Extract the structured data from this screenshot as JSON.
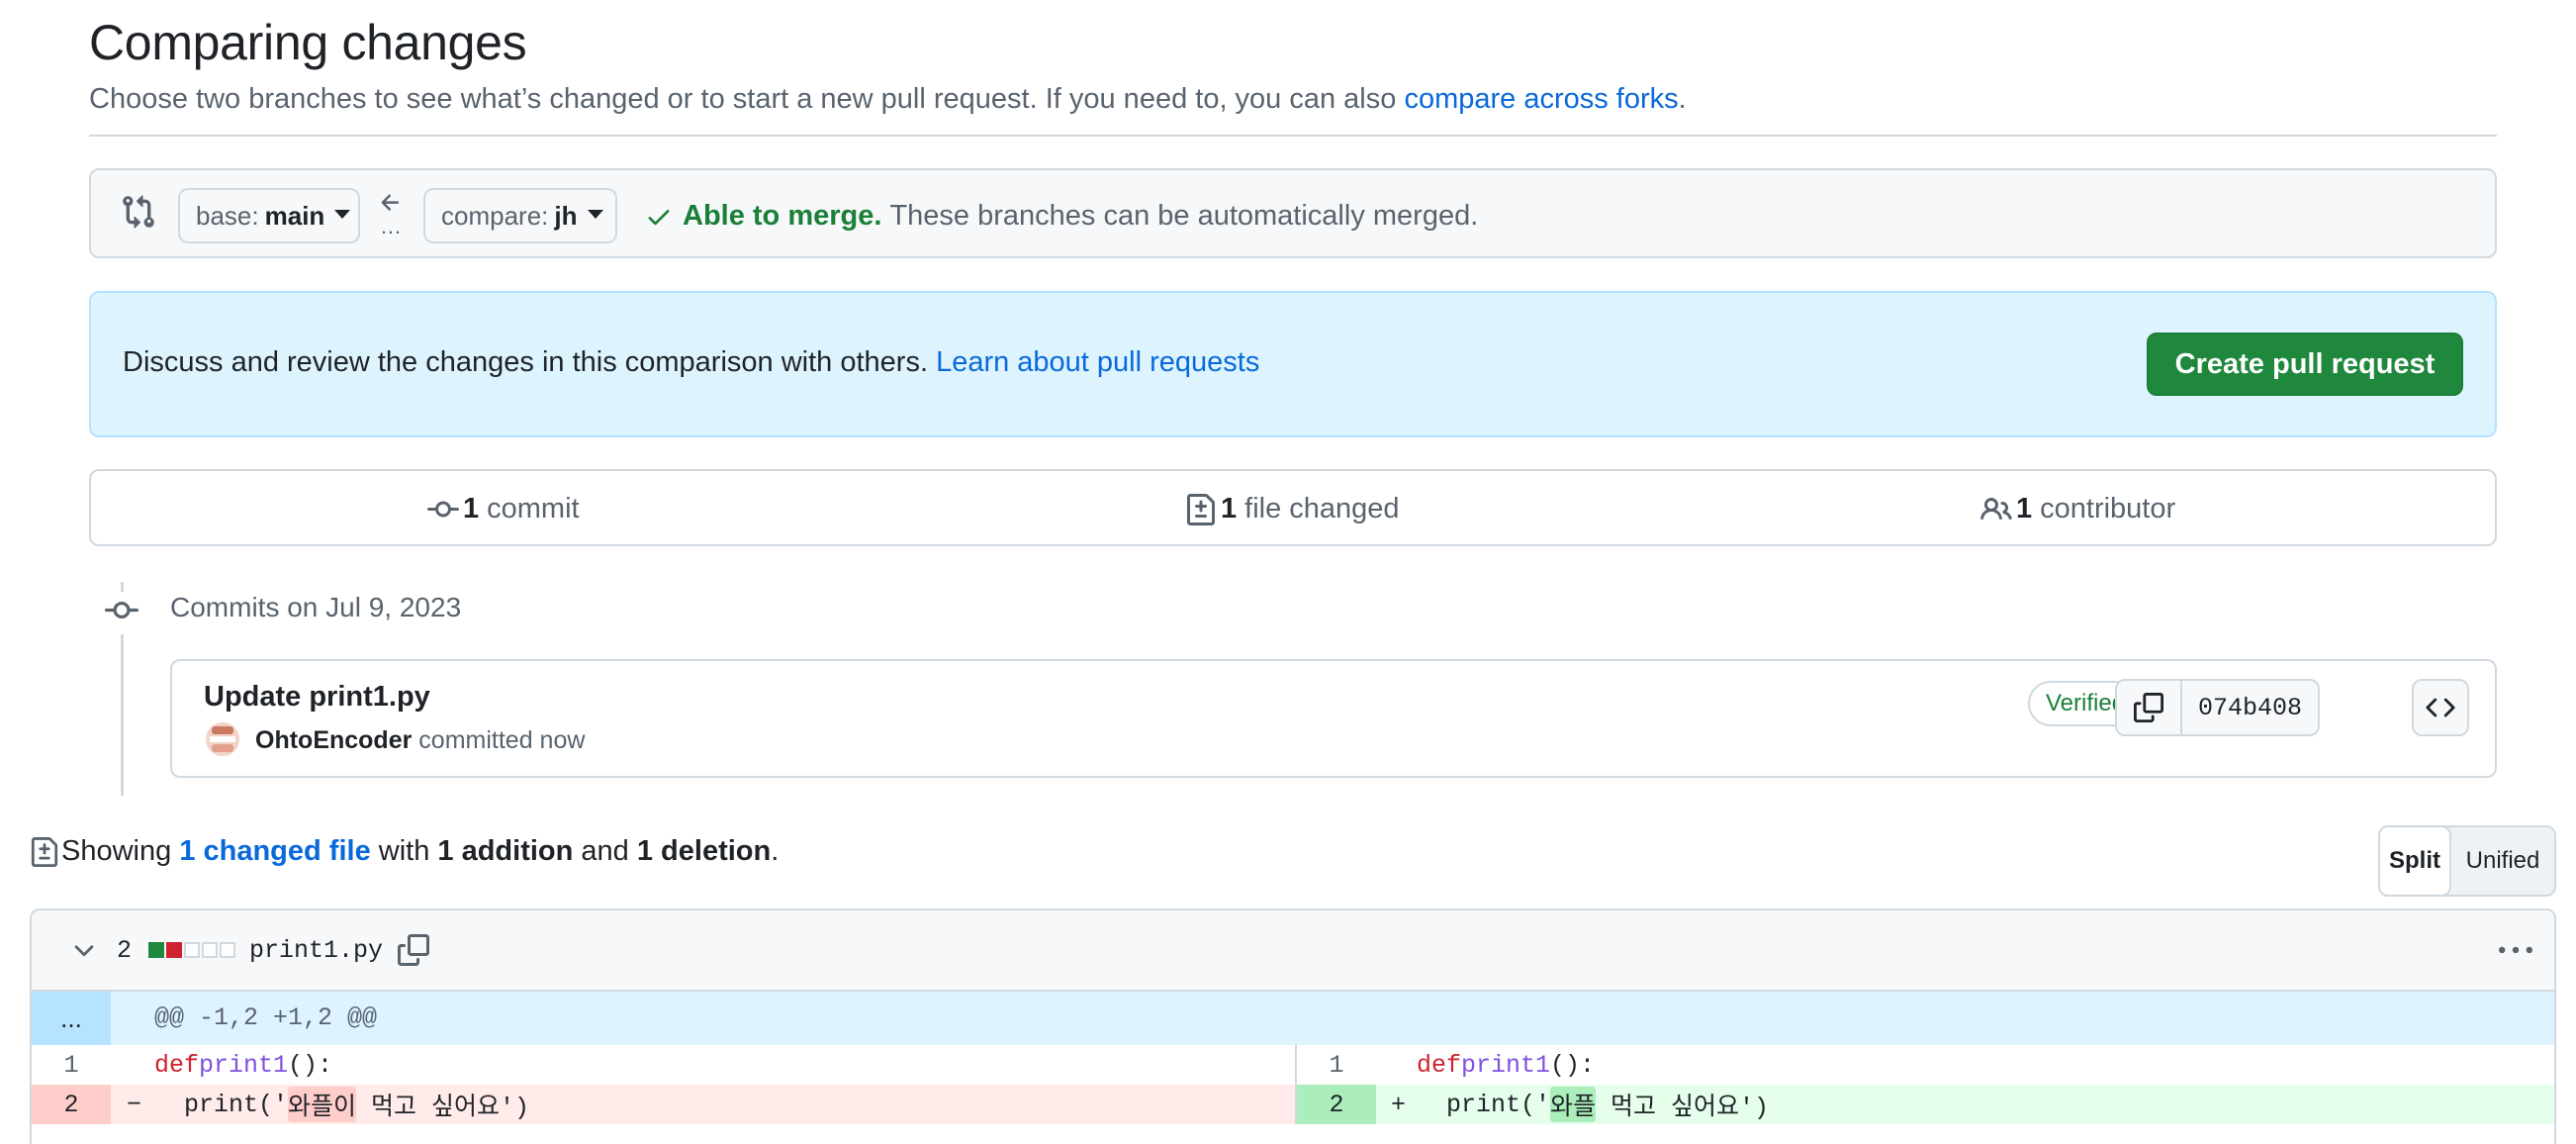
{
  "header": {
    "title": "Comparing changes",
    "subtitle": "Choose two branches to see what’s changed or to start a new pull request. If you need to, you can also ",
    "subtitle_link": "compare across forks",
    "subtitle_end": "."
  },
  "compare": {
    "base_label": "base:",
    "base_value": "main",
    "compare_label": "compare:",
    "compare_value": "jh",
    "merge_ok": "Able to merge.",
    "merge_text": "These branches can be automatically merged."
  },
  "flash": {
    "text": "Discuss and review the changes in this comparison with others. ",
    "link": "Learn about pull requests",
    "button": "Create pull request"
  },
  "summary": {
    "commits_count": "1",
    "commits_label": "commit",
    "files_count": "1",
    "files_label": "file changed",
    "contributors_count": "1",
    "contributors_label": "contributor"
  },
  "timeline": {
    "date_heading": "Commits on Jul 9, 2023",
    "commit": {
      "title": "Update print1.py",
      "author": "OhtoEncoder",
      "time": "committed now",
      "verified": "Verified",
      "sha": "074b408"
    }
  },
  "showing": {
    "prefix": "Showing",
    "files_link": "1 changed file",
    "with": "with",
    "additions": "1 addition",
    "and": "and",
    "deletions": "1 deletion",
    "end": "."
  },
  "view_toggle": {
    "split": "Split",
    "unified": "Unified"
  },
  "diff": {
    "change_count": "2",
    "filename": "print1.py",
    "hunk_expander": "...",
    "hunk_header": "@@ -1,2 +1,2 @@",
    "left": [
      {
        "num": "1",
        "marker": "",
        "kw": "def",
        "fn": "print1",
        "rest": "():"
      },
      {
        "num": "2",
        "marker": "−",
        "pre": "print('",
        "hl": "와플이",
        "post": " 먹고 싶어요')"
      }
    ],
    "right": [
      {
        "num": "1",
        "marker": "",
        "kw": "def",
        "fn": "print1",
        "rest": "():"
      },
      {
        "num": "2",
        "marker": "+",
        "pre": "print('",
        "hl": "와플",
        "post": " 먹고 싶어요')"
      }
    ]
  },
  "colors": {
    "accent": "#0969da",
    "success": "#1f883d",
    "deletion_bg": "#ffebe9",
    "addition_bg": "#e6ffec",
    "hunk_bg": "#ddf4ff"
  }
}
